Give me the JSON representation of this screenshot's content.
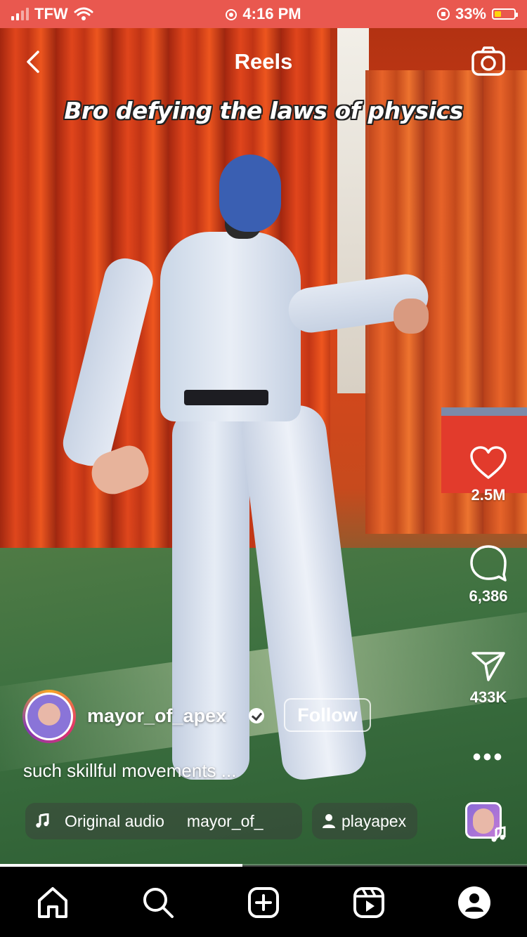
{
  "status_bar": {
    "carrier": "TFW",
    "time": "4:16 PM",
    "battery_percent": "33%",
    "battery_level": 0.33,
    "color": "#e9584f"
  },
  "header": {
    "title": "Reels",
    "back_icon": "chevron-left-icon",
    "camera_icon": "camera-icon"
  },
  "video": {
    "caption_overlay": "Bro defying the laws of physics",
    "progress": 0.46
  },
  "actions": {
    "likes": "2.5M",
    "comments": "6,386",
    "shares": "433K",
    "more_icon": "more-icon"
  },
  "author": {
    "username": "mayor_of_apex",
    "verified": true,
    "follow_label": "Follow"
  },
  "description": "such skillful movements ...",
  "audio": {
    "label": "Original audio",
    "artist": "mayor_of_",
    "tagged_user": "playapex"
  },
  "tabbar": {
    "items": [
      "home-icon",
      "search-icon",
      "create-icon",
      "reels-icon",
      "profile-icon"
    ]
  }
}
